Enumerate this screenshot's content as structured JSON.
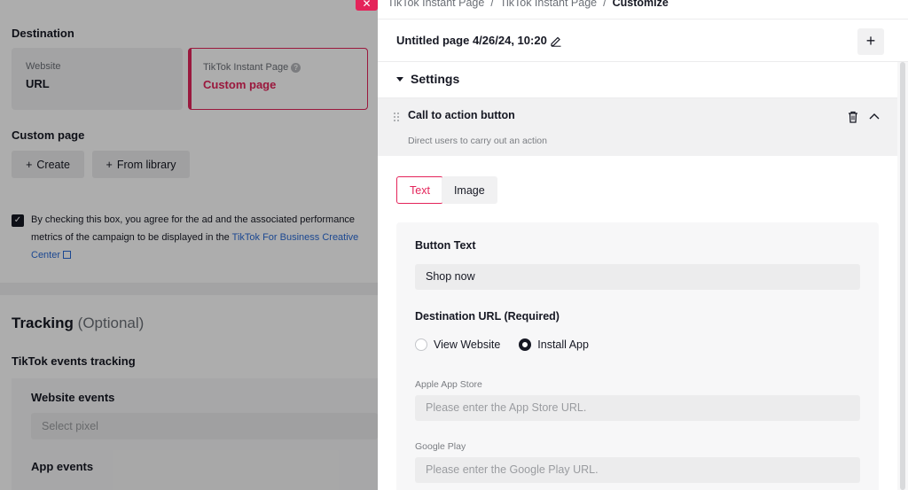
{
  "left": {
    "destination_label": "Destination",
    "website_card": {
      "small": "Website",
      "value": "URL"
    },
    "instant_card": {
      "small": "TikTok Instant Page",
      "value": "Custom page"
    },
    "custom_page_label": "Custom page",
    "create_button": "Create",
    "library_button": "From library",
    "consent_text": "By checking this box, you agree for the ad and the associated performance metrics of the campaign to be displayed in the",
    "consent_link": "TikTok For Business Creative Center",
    "tracking_title": "Tracking",
    "tracking_optional": "(Optional)",
    "events_tracking_label": "TikTok events tracking",
    "website_events_label": "Website events",
    "select_pixel_placeholder": "Select pixel",
    "app_events_label": "App events"
  },
  "panel": {
    "breadcrumb": [
      "TikTok Instant Page",
      "TikTok Instant Page",
      "Customize"
    ],
    "page_title": "Untitled page 4/26/24, 10:20",
    "settings_label": "Settings",
    "cta_title": "Call to action button",
    "cta_description": "Direct users to carry out an action",
    "tabs": {
      "text": "Text",
      "image": "Image"
    },
    "button_text_label": "Button Text",
    "button_text_value": "Shop now",
    "destination_url_label": "Destination URL (Required)",
    "radio_view_website": "View Website",
    "radio_install_app": "Install App",
    "apple_store_label": "Apple App Store",
    "apple_store_placeholder": "Please enter the App Store URL.",
    "google_play_label": "Google Play",
    "google_play_placeholder": "Please enter the Google Play URL."
  },
  "colors": {
    "accent": "#e4245a",
    "link": "#2a6bd6",
    "text": "#161823"
  }
}
